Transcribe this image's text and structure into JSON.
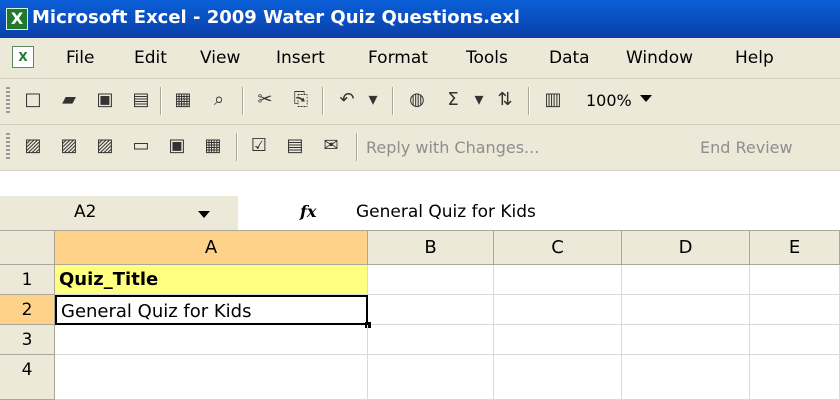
{
  "window": {
    "title": "Microsoft Excel - 2009 Water Quiz Questions.exl",
    "app_icon": "excel-icon"
  },
  "menu": {
    "items": [
      {
        "label": "File"
      },
      {
        "label": "Edit"
      },
      {
        "label": "View"
      },
      {
        "label": "Insert"
      },
      {
        "label": "Format"
      },
      {
        "label": "Tools"
      },
      {
        "label": "Data"
      },
      {
        "label": "Window"
      },
      {
        "label": "Help"
      }
    ]
  },
  "toolbar_standard": {
    "icons": [
      "new-icon",
      "open-icon",
      "save-icon",
      "permission-icon",
      "print-icon",
      "print-preview-icon",
      "cut-icon",
      "copy-icon",
      "undo-icon",
      "hyperlink-icon",
      "autosum-icon",
      "sort-ascending-icon",
      "chart-wizard-icon"
    ],
    "zoom": "100%"
  },
  "toolbar_reviewing": {
    "icons": [
      "review-icon-1",
      "review-icon-2",
      "review-icon-3",
      "review-icon-4",
      "review-icon-5",
      "review-icon-6",
      "review-icon-7",
      "review-icon-8",
      "review-icon-9"
    ],
    "reply_label": "Reply with Changes...",
    "end_review_label": "End Review"
  },
  "formula_bar": {
    "name_box": "A2",
    "fx_label": "fx",
    "formula": "General Quiz for Kids"
  },
  "sheet": {
    "columns": [
      "A",
      "B",
      "C",
      "D",
      "E"
    ],
    "rows": [
      "1",
      "2",
      "3",
      "4"
    ],
    "cells": {
      "A1": "Quiz_Title",
      "A2": "General Quiz for Kids"
    },
    "highlight_color": "#ffff80",
    "selected_cell": "A2"
  }
}
